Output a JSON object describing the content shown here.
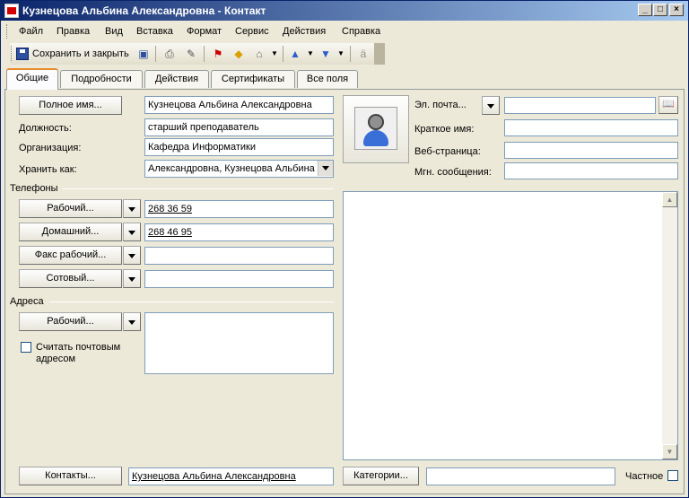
{
  "window": {
    "title": "Кузнецова Альбина Александровна - Контакт",
    "controls": {
      "minimize": "_",
      "maximize": "□",
      "close": "×"
    }
  },
  "menu": [
    "Файл",
    "Правка",
    "Вид",
    "Вставка",
    "Формат",
    "Сервис",
    "Действия",
    "Справка"
  ],
  "toolbar": {
    "save_close_label": "Сохранить и закрыть",
    "icons": [
      "save-icon",
      "save-as-icon",
      "print-icon",
      "attach-icon",
      "flag-icon",
      "category-icon",
      "map-icon",
      "previous-icon",
      "next-icon",
      "spellcheck-icon"
    ]
  },
  "tabs": [
    "Общие",
    "Подробности",
    "Действия",
    "Сертификаты",
    "Все поля"
  ],
  "active_tab": "Общие",
  "name_section": {
    "full_name_button": "Полное имя...",
    "full_name_value": "Кузнецова Альбина Александровна",
    "position_label": "Должность:",
    "position_value": "старший преподаватель",
    "organization_label": "Организация:",
    "organization_value": "Кафедра Информатики",
    "file_as_label": "Хранить как:",
    "file_as_value": "Александровна, Кузнецова Альбина"
  },
  "phones": {
    "group_label": "Телефоны",
    "rows": [
      {
        "button": "Рабочий...",
        "value": "268 36 59"
      },
      {
        "button": "Домашний...",
        "value": "268 46 95"
      },
      {
        "button": "Факс рабочий...",
        "value": ""
      },
      {
        "button": "Сотовый...",
        "value": ""
      }
    ]
  },
  "addresses": {
    "group_label": "Адреса",
    "type_button": "Рабочий...",
    "mailing_checkbox_label_line1": "Считать почтовым",
    "mailing_checkbox_label_line2": "адресом",
    "mailing_checked": false,
    "value": ""
  },
  "internet": {
    "email_button": "Эл. почта...",
    "email_value": "",
    "display_as_label": "Краткое имя:",
    "display_as_value": "",
    "webpage_label": "Веб-страница:",
    "webpage_value": "",
    "im_label": "Мгн. сообщения:",
    "im_value": ""
  },
  "footer": {
    "contacts_button": "Контакты...",
    "contacts_value": "Кузнецова Альбина Александровна",
    "categories_button": "Категории...",
    "categories_value": "",
    "private_label": "Частное",
    "private_checked": false
  },
  "colors": {
    "titlebar_start": "#0a246a",
    "titlebar_end": "#a6caf0",
    "window_bg": "#ece9d8",
    "active_tab_accent": "#e68b2c"
  }
}
